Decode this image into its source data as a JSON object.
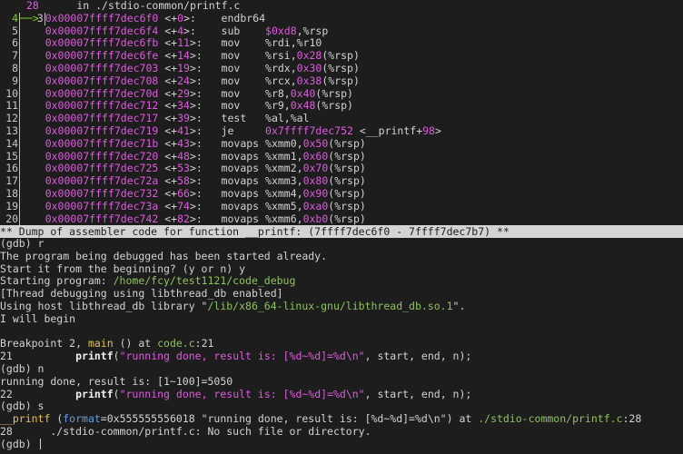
{
  "asm": {
    "source_row": {
      "ln": "3",
      "src_line": "28",
      "text": "in ./stdio-common/printf.c"
    },
    "current_arrow": "──>",
    "rows": [
      {
        "ln": "4",
        "addr": "0x00007ffff7dec6f0",
        "off": "0",
        "mnem": "endbr64",
        "ops": [],
        "current": true
      },
      {
        "ln": "5",
        "addr": "0x00007ffff7dec6f4",
        "off": "4",
        "mnem": "sub",
        "ops": [
          [
            "$0xd8",
            1
          ],
          [
            ",%rsp",
            0
          ]
        ]
      },
      {
        "ln": "6",
        "addr": "0x00007ffff7dec6fb",
        "off": "11",
        "mnem": "mov",
        "ops": [
          [
            "%rdi,%r10",
            0
          ]
        ]
      },
      {
        "ln": "7",
        "addr": "0x00007ffff7dec6fe",
        "off": "14",
        "mnem": "mov",
        "ops": [
          [
            "%rsi,",
            0
          ],
          [
            "0x28",
            1
          ],
          [
            "(%rsp)",
            0
          ]
        ]
      },
      {
        "ln": "8",
        "addr": "0x00007ffff7dec703",
        "off": "19",
        "mnem": "mov",
        "ops": [
          [
            "%rdx,",
            0
          ],
          [
            "0x30",
            1
          ],
          [
            "(%rsp)",
            0
          ]
        ]
      },
      {
        "ln": "9",
        "addr": "0x00007ffff7dec708",
        "off": "24",
        "mnem": "mov",
        "ops": [
          [
            "%rcx,",
            0
          ],
          [
            "0x38",
            1
          ],
          [
            "(%rsp)",
            0
          ]
        ]
      },
      {
        "ln": "10",
        "addr": "0x00007ffff7dec70d",
        "off": "29",
        "mnem": "mov",
        "ops": [
          [
            "%r8,",
            0
          ],
          [
            "0x40",
            1
          ],
          [
            "(%rsp)",
            0
          ]
        ]
      },
      {
        "ln": "11",
        "addr": "0x00007ffff7dec712",
        "off": "34",
        "mnem": "mov",
        "ops": [
          [
            "%r9,",
            0
          ],
          [
            "0x48",
            1
          ],
          [
            "(%rsp)",
            0
          ]
        ]
      },
      {
        "ln": "12",
        "addr": "0x00007ffff7dec717",
        "off": "39",
        "mnem": "test",
        "ops": [
          [
            "%al,%al",
            0
          ]
        ]
      },
      {
        "ln": "13",
        "addr": "0x00007ffff7dec719",
        "off": "41",
        "mnem": "je",
        "ops": [
          [
            "0x7ffff7dec752",
            1
          ],
          [
            " <__printf+",
            0
          ],
          [
            "98",
            1
          ],
          [
            ">",
            0
          ]
        ]
      },
      {
        "ln": "14",
        "addr": "0x00007ffff7dec71b",
        "off": "43",
        "mnem": "movaps",
        "ops": [
          [
            "%xmm0,",
            0
          ],
          [
            "0x50",
            1
          ],
          [
            "(%rsp)",
            0
          ]
        ]
      },
      {
        "ln": "15",
        "addr": "0x00007ffff7dec720",
        "off": "48",
        "mnem": "movaps",
        "ops": [
          [
            "%xmm1,",
            0
          ],
          [
            "0x60",
            1
          ],
          [
            "(%rsp)",
            0
          ]
        ]
      },
      {
        "ln": "16",
        "addr": "0x00007ffff7dec725",
        "off": "53",
        "mnem": "movaps",
        "ops": [
          [
            "%xmm2,",
            0
          ],
          [
            "0x70",
            1
          ],
          [
            "(%rsp)",
            0
          ]
        ]
      },
      {
        "ln": "17",
        "addr": "0x00007ffff7dec72a",
        "off": "58",
        "mnem": "movaps",
        "ops": [
          [
            "%xmm3,",
            0
          ],
          [
            "0x80",
            1
          ],
          [
            "(%rsp)",
            0
          ]
        ]
      },
      {
        "ln": "18",
        "addr": "0x00007ffff7dec732",
        "off": "66",
        "mnem": "movaps",
        "ops": [
          [
            "%xmm4,",
            0
          ],
          [
            "0x90",
            1
          ],
          [
            "(%rsp)",
            0
          ]
        ]
      },
      {
        "ln": "19",
        "addr": "0x00007ffff7dec73a",
        "off": "74",
        "mnem": "movaps",
        "ops": [
          [
            "%xmm5,",
            0
          ],
          [
            "0xa0",
            1
          ],
          [
            "(%rsp)",
            0
          ]
        ]
      },
      {
        "ln": "20",
        "addr": "0x00007ffff7dec742",
        "off": "82",
        "mnem": "movaps",
        "ops": [
          [
            "%xmm6,",
            0
          ],
          [
            "0xb0",
            1
          ],
          [
            "(%rsp)",
            0
          ]
        ]
      }
    ]
  },
  "status_bar": "** Dump of assembler code for function __printf: (7ffff7dec6f0 - 7ffff7dec7b7) **",
  "console": [
    [
      [
        "(gdb) r",
        ""
      ]
    ],
    [
      [
        "The program being debugged has been started already.",
        ""
      ]
    ],
    [
      [
        "Start it from the beginning? (y or n) y",
        ""
      ]
    ],
    [
      [
        "Starting program: ",
        ""
      ],
      [
        "/home/fcy/test1121/code_debug",
        "g"
      ]
    ],
    [
      [
        "[Thread debugging using libthread_db enabled]",
        ""
      ]
    ],
    [
      [
        "Using host libthread_db library \"",
        ""
      ],
      [
        "/lib/x86_64-linux-gnu/libthread_db.so.1",
        "g"
      ],
      [
        "\".",
        ""
      ]
    ],
    [
      [
        "I will begin",
        ""
      ]
    ],
    [],
    [
      [
        "Breakpoint 2, ",
        ""
      ],
      [
        "main",
        "y"
      ],
      [
        " () at ",
        ""
      ],
      [
        "code.c",
        "g"
      ],
      [
        ":21",
        ""
      ]
    ],
    [
      [
        "21          ",
        ""
      ],
      [
        "printf",
        "w"
      ],
      [
        "(",
        ""
      ],
      [
        "\"running done, result is: [%d~%d]=%d\\n\"",
        "h"
      ],
      [
        ", start, end, n);",
        ""
      ]
    ],
    [
      [
        "(gdb) n",
        ""
      ]
    ],
    [
      [
        "running done, result is: [1~100]=5050",
        ""
      ]
    ],
    [
      [
        "22          ",
        ""
      ],
      [
        "printf",
        "w"
      ],
      [
        "(",
        ""
      ],
      [
        "\"running done, result is: [%d~%d]=%d\\n\"",
        "h"
      ],
      [
        ", start, end, n);",
        ""
      ]
    ],
    [
      [
        "(gdb) s",
        ""
      ]
    ],
    [
      [
        "__printf",
        "y"
      ],
      [
        " (",
        ""
      ],
      [
        "format",
        "b"
      ],
      [
        "=0x555555556018 \"running done, result is: [%d~%d]=%d\\n\") at ",
        ""
      ],
      [
        "./stdio-common/printf.c",
        "g"
      ],
      [
        ":28",
        ""
      ]
    ],
    [
      [
        "28      ./stdio-common/printf.c: No such file or directory.",
        ""
      ]
    ],
    [
      [
        "(gdb) ",
        ""
      ]
    ]
  ],
  "colors": {
    "address": "#e05ae0",
    "path": "#8fc25f",
    "function": "#e0c060",
    "arg": "#5f9fe0",
    "background": "#1d1d1d"
  }
}
